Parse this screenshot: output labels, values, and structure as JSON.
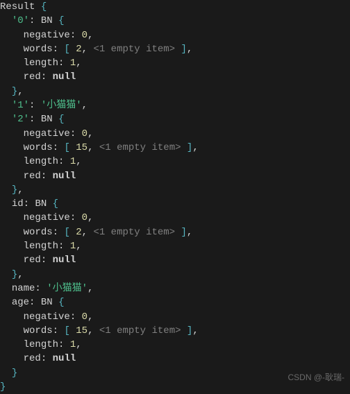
{
  "top_label": "Result",
  "bn_label": "BN",
  "keys": {
    "k0": "'0'",
    "k1": "'1'",
    "k2": "'2'",
    "id": "id",
    "name": "name",
    "age": "age",
    "negative": "negative",
    "words": "words",
    "length": "length",
    "red": "red"
  },
  "vals": {
    "zero": "0",
    "one": "1",
    "two": "2",
    "fifteen": "15",
    "null": "null",
    "cat": "'小猫猫'",
    "empty_item": "<1 empty item>"
  },
  "punct": {
    "brace_open": "{",
    "brace_close": "}",
    "bracket_open": "[",
    "bracket_close": "]",
    "colon": ":",
    "comma": ","
  },
  "watermark": "CSDN @-耿瑞-"
}
